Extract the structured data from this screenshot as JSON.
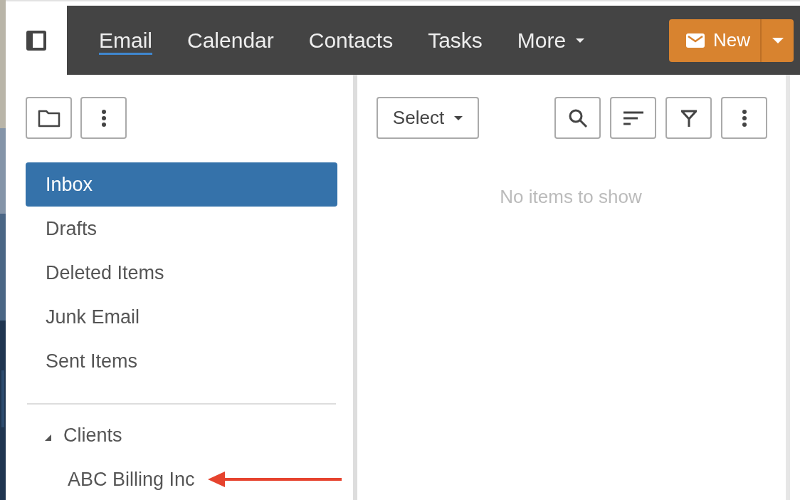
{
  "nav": {
    "tabs": [
      {
        "label": "Email",
        "selected": true
      },
      {
        "label": "Calendar",
        "selected": false
      },
      {
        "label": "Contacts",
        "selected": false
      },
      {
        "label": "Tasks",
        "selected": false
      }
    ],
    "more": {
      "label": "More"
    }
  },
  "new_button": {
    "label": "New"
  },
  "folder_pane": {
    "folders": [
      {
        "label": "Inbox",
        "selected": true
      },
      {
        "label": "Drafts",
        "selected": false
      },
      {
        "label": "Deleted Items",
        "selected": false
      },
      {
        "label": "Junk Email",
        "selected": false
      },
      {
        "label": "Sent Items",
        "selected": false
      }
    ],
    "groups": [
      {
        "label": "Clients",
        "expanded": true,
        "children": [
          {
            "label": "ABC Billing Inc",
            "selected": false
          }
        ]
      }
    ]
  },
  "message_pane": {
    "select": {
      "label": "Select"
    },
    "empty_text": "No items to show"
  }
}
